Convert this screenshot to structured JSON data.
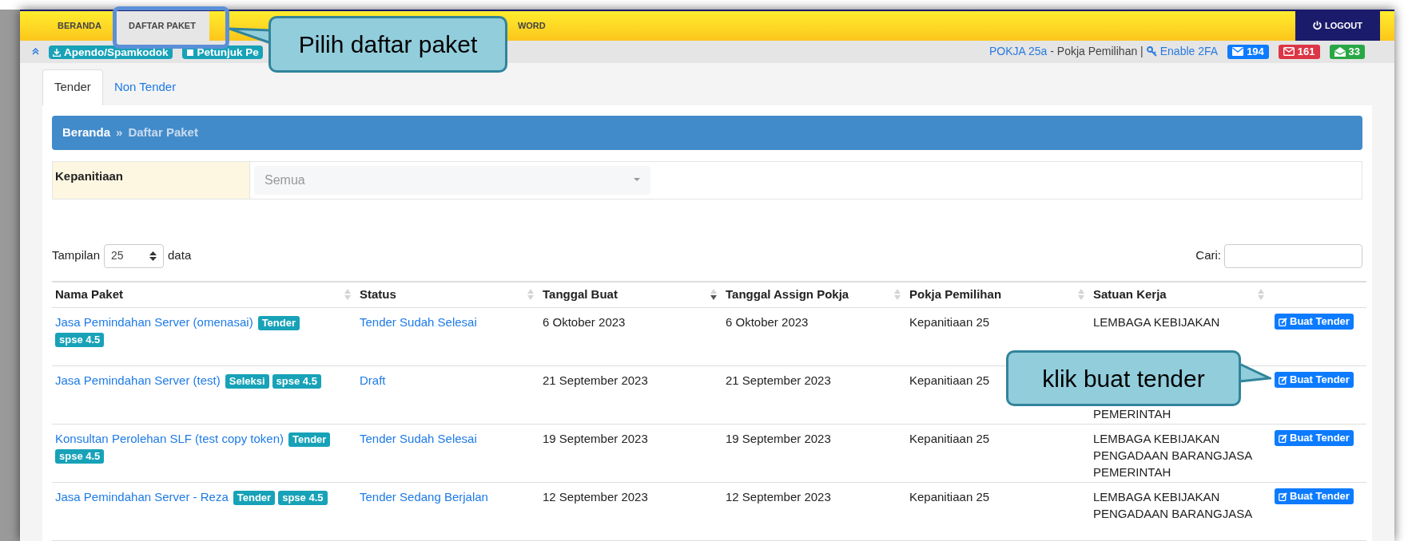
{
  "navbar": {
    "items": [
      {
        "label": "BERANDA",
        "selected": false
      },
      {
        "label": "DAFTAR PAKET",
        "selected": true
      },
      {
        "label": "WORD",
        "selected": false
      }
    ],
    "logout": "LOGOUT"
  },
  "subbar": {
    "buttons": [
      "Apendo/Spamkodok",
      "Petunjuk Pe"
    ],
    "user_link": "POKJA 25a",
    "role": " - Pokja Pemilihan |",
    "enable_2fa": "Enable 2FA",
    "badges": [
      {
        "kind": "inbox",
        "count": "194",
        "color": "#0d7bff"
      },
      {
        "kind": "unread",
        "count": "161",
        "color": "#dc3545"
      },
      {
        "kind": "read",
        "count": "33",
        "color": "#28a745"
      }
    ]
  },
  "tabs": [
    {
      "label": "Tender",
      "selected": true
    },
    {
      "label": "Non Tender",
      "selected": false
    }
  ],
  "breadcrumb": {
    "home": "Beranda",
    "separator": "»",
    "current": "Daftar Paket"
  },
  "filter": {
    "label": "Kepanitiaan",
    "placeholder": "Semua"
  },
  "length": {
    "prefix": "Tampilan",
    "value": "25",
    "suffix": "data"
  },
  "search": {
    "label": "Cari:"
  },
  "table": {
    "columns": [
      {
        "label": "Nama Paket",
        "sorted": false
      },
      {
        "label": "Status",
        "sorted": false
      },
      {
        "label": "Tanggal Buat",
        "sorted": true
      },
      {
        "label": "Tanggal Assign Pokja",
        "sorted": false
      },
      {
        "label": "Pokja Pemilihan",
        "sorted": false
      },
      {
        "label": "Satuan Kerja",
        "sorted": false
      }
    ],
    "rows": [
      {
        "name": "Jasa Pemindahan Server (omenasai)",
        "tags": [
          "Tender",
          "spse 4.5"
        ],
        "status": "Tender Sudah Selesai",
        "tanggal_buat": "6 Oktober 2023",
        "tanggal_assign": "6 Oktober 2023",
        "pokja": "Kepanitiaan 25",
        "satuan_kerja": "LEMBAGA KEBIJAKAN",
        "satuan_kerja_covered_above": false,
        "action": "Buat Tender"
      },
      {
        "name": "Jasa Pemindahan Server (test)",
        "tags": [
          "Seleksi",
          "spse 4.5"
        ],
        "status": "Draft",
        "tanggal_buat": "21 September 2023",
        "tanggal_assign": "21 September 2023",
        "pokja": "Kepanitiaan 25",
        "satuan_kerja": "PEMERINTAH",
        "satuan_kerja_covered_above": true,
        "action": "Buat Tender"
      },
      {
        "name": "Konsultan Perolehan SLF (test copy token)",
        "tags": [
          "Tender",
          "spse 4.5"
        ],
        "status": "Tender Sudah Selesai",
        "tanggal_buat": "19 September 2023",
        "tanggal_assign": "19 September 2023",
        "pokja": "Kepanitiaan 25",
        "satuan_kerja": "LEMBAGA KEBIJAKAN PENGADAAN BARANGJASA PEMERINTAH",
        "action": "Buat Tender"
      },
      {
        "name": "Jasa Pemindahan Server - Reza",
        "tags": [
          "Tender",
          "spse 4.5"
        ],
        "status": "Tender Sedang Berjalan",
        "tanggal_buat": "12 September 2023",
        "tanggal_assign": "12 September 2023",
        "pokja": "Kepanitiaan 25",
        "satuan_kerja": "LEMBAGA KEBIJAKAN PENGADAAN BARANGJASA",
        "action": "Buat Tender"
      }
    ]
  },
  "callouts": [
    {
      "text": "Pilih daftar paket"
    },
    {
      "text": "klik buat tender"
    }
  ]
}
